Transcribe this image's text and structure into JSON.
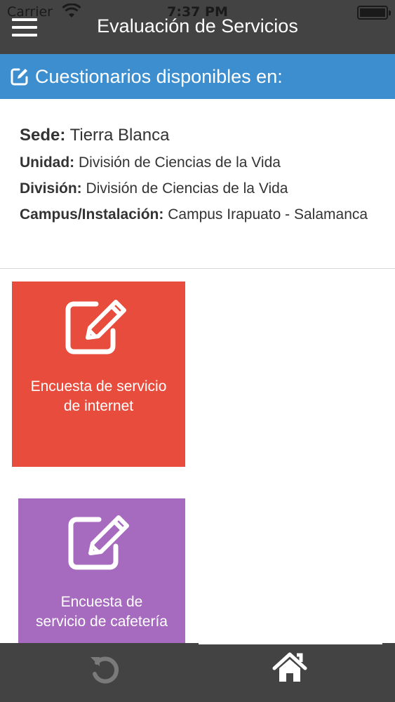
{
  "status_bar": {
    "carrier": "Carrier",
    "time": "7:37 PM"
  },
  "header": {
    "title": "Evaluación de Servicios",
    "menu_icon": "hamburger-menu-icon"
  },
  "section": {
    "icon": "edit-square-icon",
    "label": "Cuestionarios disponibles en:"
  },
  "info": {
    "sede_label": "Sede:",
    "sede_value": "Tierra Blanca",
    "unidad_label": "Unidad:",
    "unidad_value": "División de Ciencias de la Vida",
    "division_label": "División:",
    "division_value": "División de Ciencias de la Vida",
    "campus_label": "Campus/Instalación:",
    "campus_value": "Campus Irapuato - Salamanca"
  },
  "surveys": [
    {
      "label_line1": "Encuesta de servicio",
      "label_line2": "de internet",
      "color": "#e74c3c",
      "icon": "edit-square-icon"
    },
    {
      "label_line1": "Encuesta de",
      "label_line2": "servicio de cafetería",
      "color": "#a66bbe",
      "icon": "edit-square-icon"
    }
  ],
  "tab_bar": {
    "refresh_icon": "refresh-icon",
    "home_icon": "home-icon"
  },
  "colors": {
    "header": "#434343",
    "section": "#3d8ecf"
  }
}
